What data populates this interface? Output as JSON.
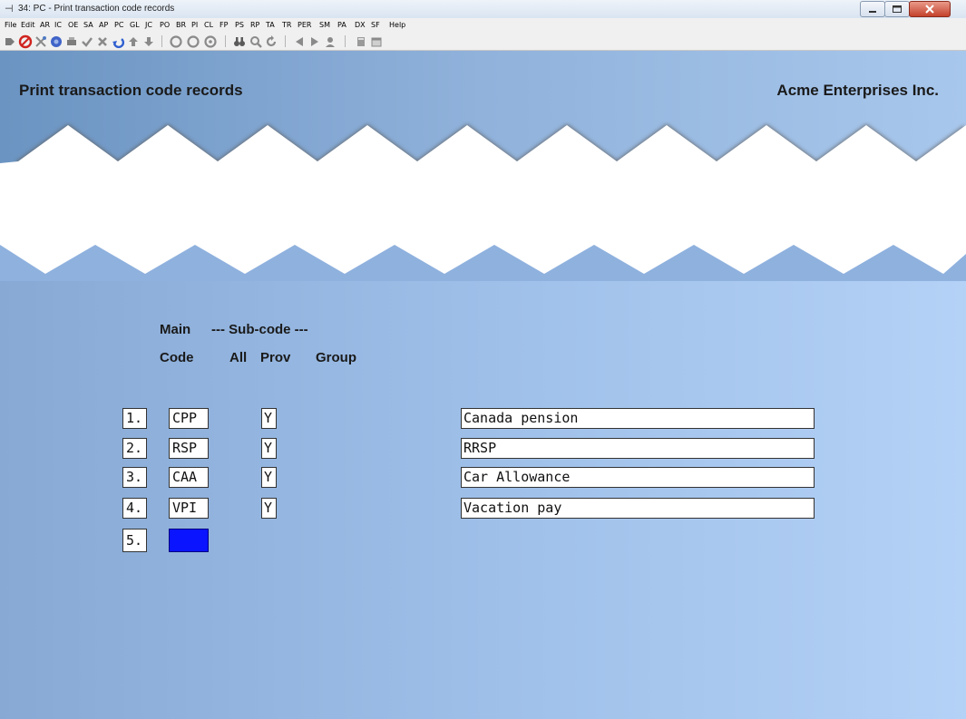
{
  "window": {
    "title": "34: PC - Print transaction code records"
  },
  "menu": [
    "File",
    "Edit",
    "AR",
    "IC",
    "OE",
    "SA",
    "AP",
    "PC",
    "GL",
    "JC",
    "PO",
    "BR",
    "PI",
    "CL",
    "FP",
    "PS",
    "RP",
    "TA",
    "TR",
    "PER",
    "SM",
    "PA",
    "DX",
    "SF",
    "Help"
  ],
  "toolbar_icons": [
    "next-icon",
    "stop-icon",
    "tools-icon",
    "help-circle-icon",
    "print-icon",
    "check-icon",
    "delete-icon",
    "undo-icon",
    "up-arrow-icon",
    "down-arrow-icon",
    "circle-icon-1",
    "circle-icon-2",
    "circle-icon-3",
    "binoculars-icon",
    "zoom-icon",
    "refresh-icon",
    "prev-icon",
    "play-icon",
    "user-icon",
    "calculator-icon",
    "calendar-icon"
  ],
  "screen": {
    "title": "Print transaction code records",
    "company": "Acme Enterprises Inc."
  },
  "headers": {
    "main": "Main",
    "subcode": "--- Sub-code ---",
    "code": "Code",
    "all": "All",
    "prov": "Prov",
    "group": "Group"
  },
  "rows": [
    {
      "num": "1.",
      "code": "CPP",
      "all": "Y",
      "description": "Canada pension"
    },
    {
      "num": "2.",
      "code": "RSP",
      "all": "Y",
      "description": "RRSP"
    },
    {
      "num": "3.",
      "code": "CAA",
      "all": "Y",
      "description": "Car Allowance"
    },
    {
      "num": "4.",
      "code": "VPI",
      "all": "Y",
      "description": "Vacation pay"
    },
    {
      "num": "5.",
      "code": "",
      "all": "",
      "description": ""
    }
  ],
  "colors": {
    "active_field": "#0a14ff",
    "background": "#9dbfe8"
  }
}
